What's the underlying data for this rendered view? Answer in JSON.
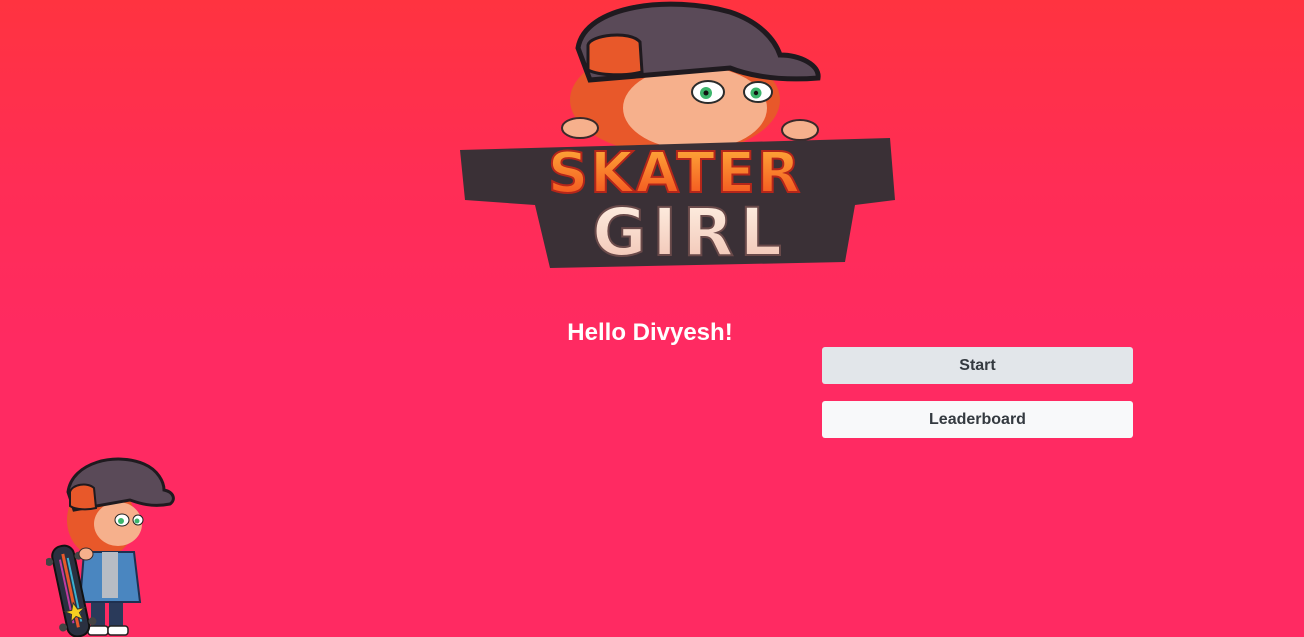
{
  "logo": {
    "line1": "SKATER",
    "line2": "GIRL"
  },
  "greeting": "Hello Divyesh!",
  "menu": {
    "start_label": "Start",
    "leaderboard_label": "Leaderboard"
  },
  "colors": {
    "background_top": "#ff3340",
    "background_bottom": "#ff2a62",
    "start_button": "#e2e6ea",
    "leaderboard_button": "#f8f9fa",
    "button_text": "#343a40",
    "greeting_text": "#ffffff"
  },
  "icons": {
    "logo": "skater-girl-logo",
    "mascot": "skater-girl-character"
  }
}
